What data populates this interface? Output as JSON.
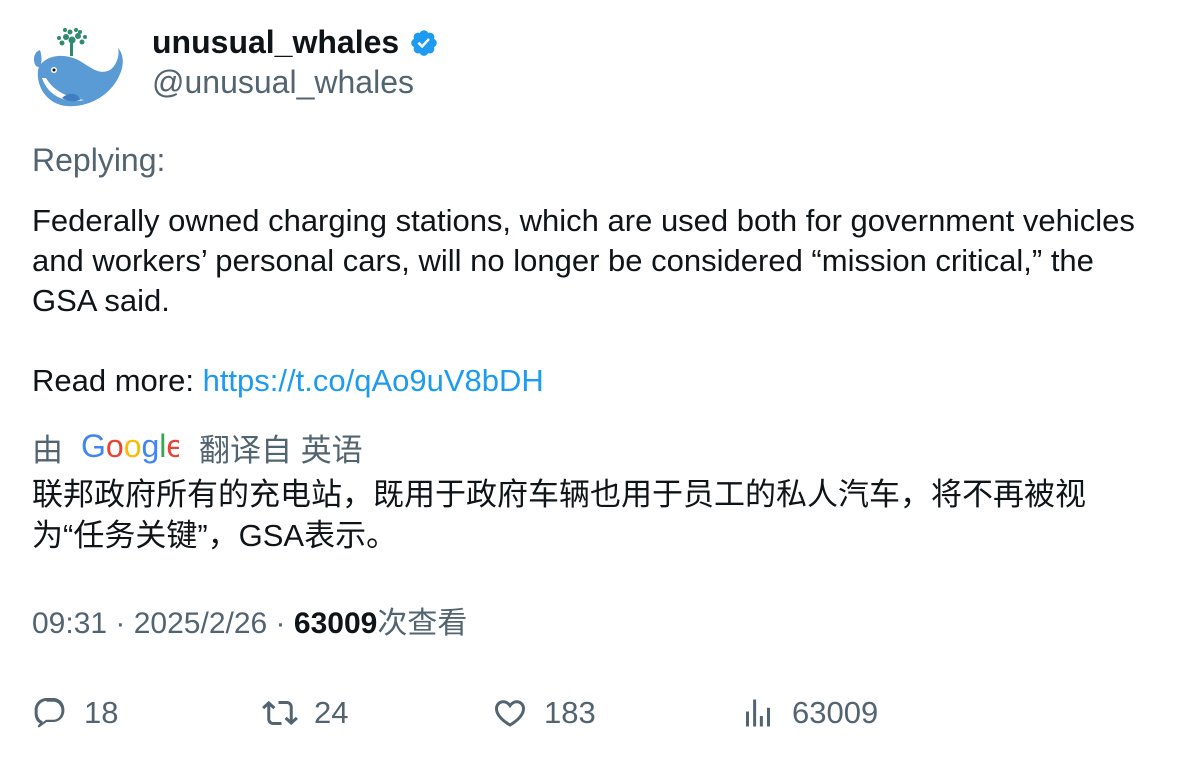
{
  "author": {
    "display_name": "unusual_whales",
    "handle": "@unusual_whales",
    "avatar_icon": "whale-logo-icon",
    "verified_icon": "verified-badge-icon",
    "verified_color": "#1d9bf0"
  },
  "tweet": {
    "replying_label": "Replying:",
    "body": "Federally owned charging stations, which are used both for government vehicles and workers’ personal cars, will no longer be considered “mission critical,” the GSA said.",
    "read_more_label": "Read more: ",
    "link": "https://t.co/qAo9uV8bDH",
    "link_color": "#1d9bf0"
  },
  "translation": {
    "by_label": "由",
    "provider": "Google",
    "from_label": "翻译自 英语",
    "text": "联邦政府所有的充电站，既用于政府车辆也用于员工的私人汽车，将不再被视为“任务关键”，GSA表示。"
  },
  "meta": {
    "time": "09:31",
    "date": "2025/2/26",
    "separator": " · ",
    "views_count": "63009",
    "views_label": "次查看"
  },
  "actions": {
    "replies": "18",
    "retweets": "24",
    "likes": "183",
    "views": "63009"
  }
}
